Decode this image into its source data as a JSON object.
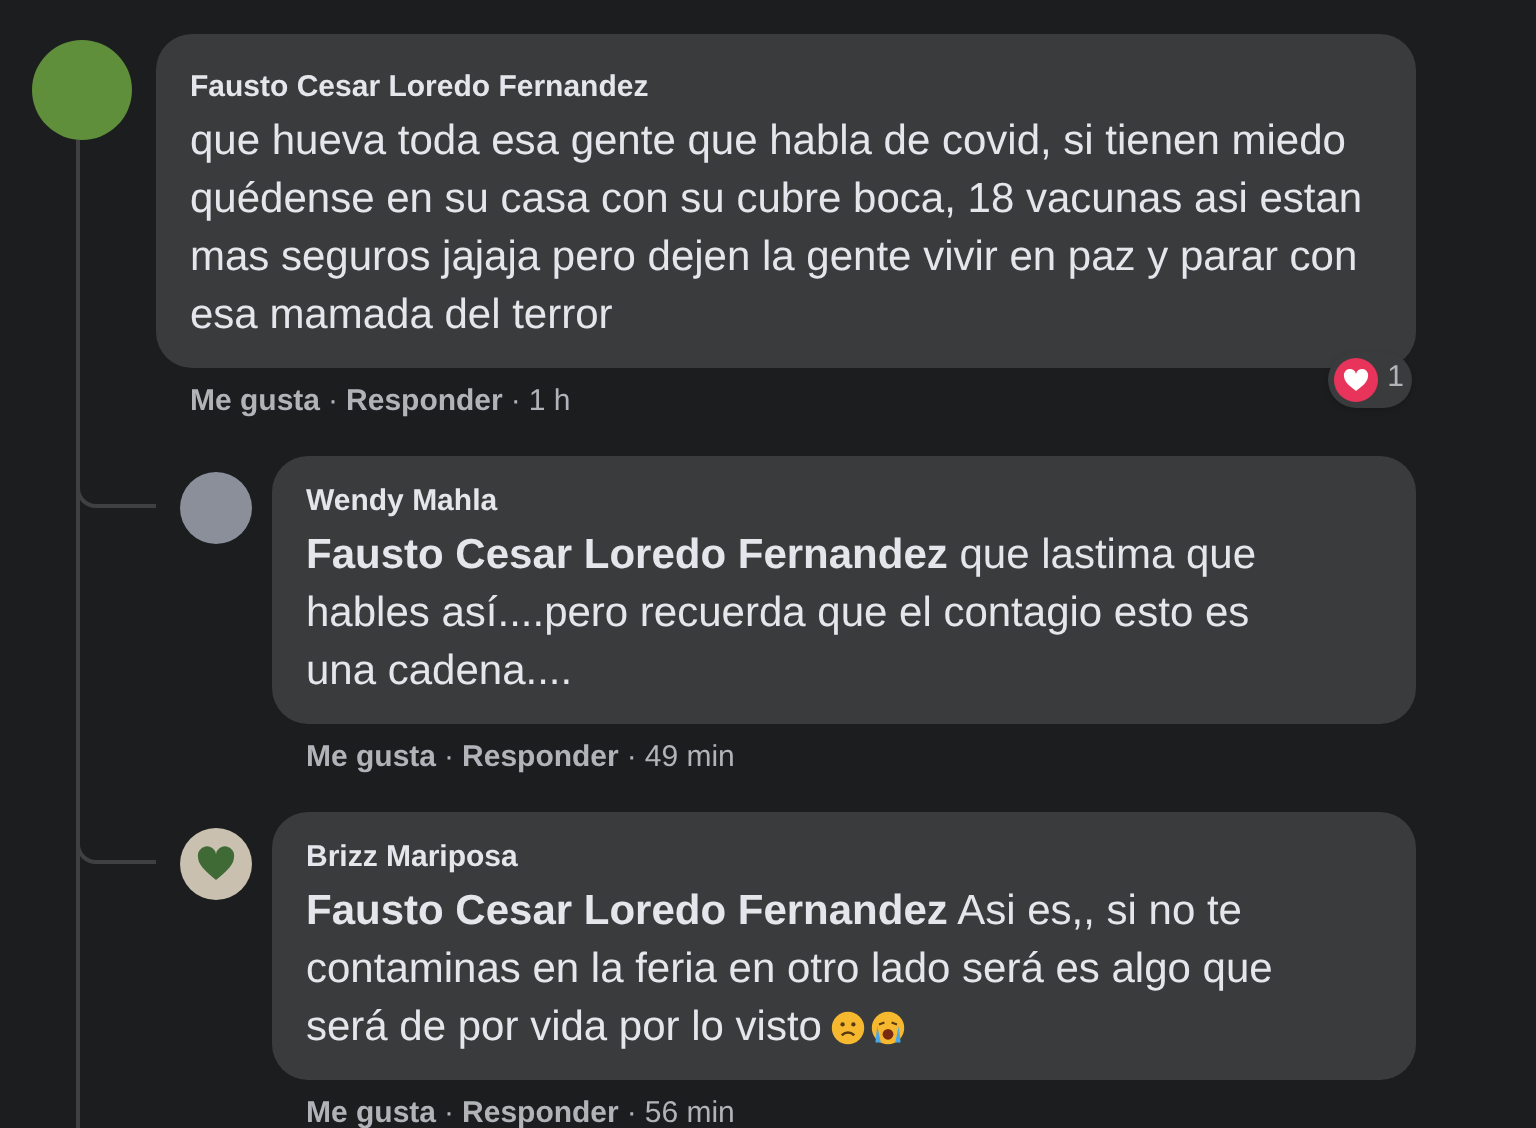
{
  "comment": {
    "author": "Fausto Cesar Loredo Fernandez",
    "text": "que hueva toda esa gente que habla de covid, si tienen miedo quédense en su casa con su cubre boca, 18 vacunas asi estan mas seguros jajaja pero dejen la gente vivir en paz y parar con esa mamada del terror",
    "reactions": {
      "kind": "heart",
      "count": "1"
    },
    "actions": {
      "like": "Me gusta",
      "separator": "·",
      "reply": "Responder",
      "time": "1 h"
    }
  },
  "replies": [
    {
      "author": "Wendy Mahla",
      "avatar": {
        "kind": "portrait"
      },
      "text": "**Fausto Cesar Loredo Fernandez** que lastima que hables así....pero recuerda que el contagio esto es una cadena....",
      "actions": {
        "like": "Me gusta",
        "separator": "·",
        "reply": "Responder",
        "time": "49 min"
      }
    },
    {
      "author": "Brizz Mariposa",
      "avatar": {
        "kind": "heart"
      },
      "text": "**Fausto Cesar Loredo Fernandez** Asi es,, si no te contaminas en la feria en otro lado será es algo que será de por vida por lo visto",
      "emoji": [
        {
          "kind": "frown"
        },
        {
          "kind": "crying"
        }
      ],
      "actions": {
        "like": "Me gusta",
        "separator": "·",
        "reply": "Responder",
        "time": "56 min"
      }
    }
  ]
}
